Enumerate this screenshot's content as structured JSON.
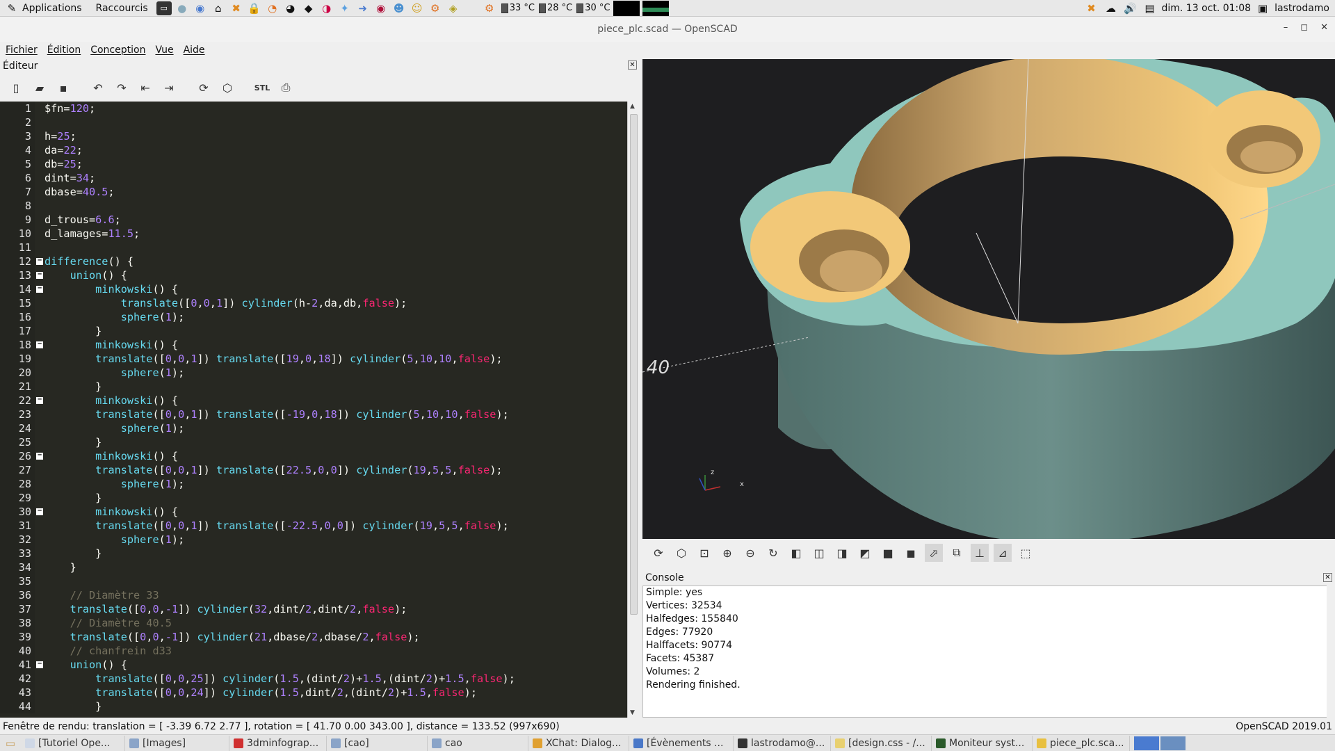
{
  "topbar": {
    "applications_label": "Applications",
    "raccourcis_label": "Raccourcis",
    "temps": [
      "33 °C",
      "28 °C",
      "30 °C"
    ],
    "datetime": "dim. 13 oct.  01:08",
    "username": "lastrodamo"
  },
  "window": {
    "title": "piece_plc.scad — OpenSCAD"
  },
  "menubar": {
    "items": [
      "Fichier",
      "Édition",
      "Conception",
      "Vue",
      "Aide"
    ]
  },
  "editor": {
    "dock_title": "Éditeur",
    "line_numbers": [
      "1",
      "2",
      "3",
      "4",
      "5",
      "6",
      "7",
      "8",
      "9",
      "10",
      "11",
      "12",
      "13",
      "14",
      "15",
      "16",
      "17",
      "18",
      "19",
      "20",
      "21",
      "22",
      "23",
      "24",
      "25",
      "26",
      "27",
      "28",
      "29",
      "30",
      "31",
      "32",
      "33",
      "34",
      "35",
      "36",
      "37",
      "38",
      "39",
      "40",
      "41",
      "42",
      "43",
      "44"
    ],
    "lines": [
      "$fn=120;",
      "",
      "h=25;",
      "da=22;",
      "db=25;",
      "dint=34;",
      "dbase=40.5;",
      "",
      "d_trous=6.6;",
      "d_lamages=11.5;",
      "",
      "difference() {",
      "    union() {",
      "        minkowski() {",
      "            translate([0,0,1]) cylinder(h-2,da,db,false);",
      "            sphere(1);",
      "        }",
      "        minkowski() {",
      "        translate([0,0,1]) translate([19,0,18]) cylinder(5,10,10,false);",
      "            sphere(1);",
      "        }",
      "        minkowski() {",
      "        translate([0,0,1]) translate([-19,0,18]) cylinder(5,10,10,false);",
      "            sphere(1);",
      "        }",
      "        minkowski() {",
      "        translate([0,0,1]) translate([22.5,0,0]) cylinder(19,5,5,false);",
      "            sphere(1);",
      "        }",
      "        minkowski() {",
      "        translate([0,0,1]) translate([-22.5,0,0]) cylinder(19,5,5,false);",
      "            sphere(1);",
      "        }",
      "    }",
      "",
      "    // Diamètre 33",
      "    translate([0,0,-1]) cylinder(32,dint/2,dint/2,false);",
      "    // Diamètre 40.5",
      "    translate([0,0,-1]) cylinder(21,dbase/2,dbase/2,false);",
      "    // chanfrein d33",
      "    union() {",
      "        translate([0,0,25]) cylinder(1.5,(dint/2)+1.5,(dint/2)+1.5,false);",
      "        translate([0,0,24]) cylinder(1.5,dint/2,(dint/2)+1.5,false);",
      "        }"
    ]
  },
  "viewport": {
    "axes": {
      "x": "x",
      "z": "z"
    },
    "scale_label": "40",
    "model_color": "#8fc7bd",
    "inner_color": "#f2c878"
  },
  "console": {
    "title": "Console",
    "lines": [
      "Simple: yes",
      "Vertices: 32534",
      "Halfedges: 155840",
      "Edges: 77920",
      "Halffacets: 90774",
      "Facets: 45387",
      "Volumes: 2",
      "Rendering finished."
    ]
  },
  "statusbar": {
    "left": "Fenêtre de rendu: translation = [ -3.39 6.72 2.77 ], rotation = [ 41.70 0.00 343.00 ], distance = 133.52 (997x690)",
    "right": "OpenSCAD 2019.01"
  },
  "taskbar": {
    "tasks": [
      {
        "label": "[Tutoriel Ope...",
        "color": "#cfd8e6"
      },
      {
        "label": "[Images]",
        "color": "#8aa4c8"
      },
      {
        "label": "3dminfograp...",
        "color": "#d03030"
      },
      {
        "label": "[cao]",
        "color": "#8aa4c8"
      },
      {
        "label": "cao",
        "color": "#8aa4c8"
      },
      {
        "label": "XChat: Dialog...",
        "color": "#e0a030"
      },
      {
        "label": "[Évènements ...",
        "color": "#4a78c8"
      },
      {
        "label": "lastrodamo@...",
        "color": "#333333"
      },
      {
        "label": "[design.css - /...",
        "color": "#e8d070"
      },
      {
        "label": "Moniteur syst...",
        "color": "#2a5a2a"
      },
      {
        "label": "piece_plc.sca...",
        "color": "#e8c040"
      }
    ]
  }
}
